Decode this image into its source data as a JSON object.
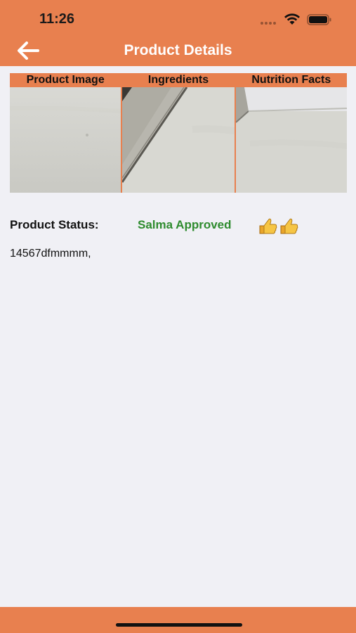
{
  "status_bar": {
    "time": "11:26"
  },
  "nav": {
    "title": "Product Details",
    "back_icon": "arrow-left-icon"
  },
  "images": [
    {
      "label": "Product Image"
    },
    {
      "label": "Ingredients"
    },
    {
      "label": "Nutrition Facts"
    }
  ],
  "product": {
    "status_label": "Product Status:",
    "status_value": "Salma Approved",
    "status_icon": "thumbs-up-icon",
    "code": "14567dfmmmm,"
  },
  "colors": {
    "accent": "#e8804f",
    "approved": "#2e8b2e",
    "background": "#f0f0f5"
  }
}
